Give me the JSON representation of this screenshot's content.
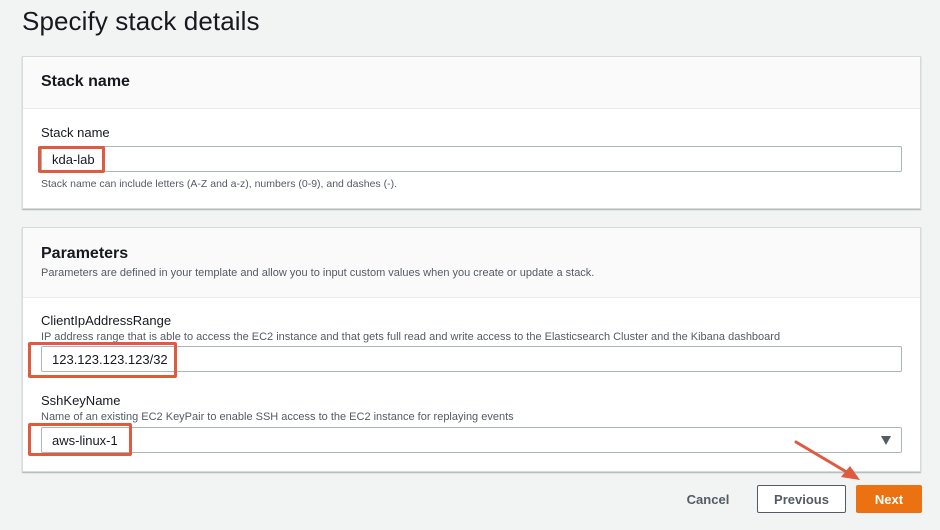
{
  "page": {
    "title": "Specify stack details"
  },
  "stack_name_panel": {
    "title": "Stack name",
    "field_label": "Stack name",
    "value": "kda-lab",
    "constraint": "Stack name can include letters (A-Z and a-z), numbers (0-9), and dashes (-)."
  },
  "parameters_panel": {
    "title": "Parameters",
    "description": "Parameters are defined in your template and allow you to input custom values when you create or update a stack.",
    "client_ip": {
      "label": "ClientIpAddressRange",
      "description": "IP address range that is able to access the EC2 instance and that gets full read and write access to the Elasticsearch Cluster and the Kibana dashboard",
      "value": "123.123.123.123/32"
    },
    "ssh_key": {
      "label": "SshKeyName",
      "description": "Name of an existing EC2 KeyPair to enable SSH access to the EC2 instance for replaying events",
      "value": "aws-linux-1",
      "dropdown_icon": "caret-down-icon"
    }
  },
  "footer": {
    "cancel_label": "Cancel",
    "previous_label": "Previous",
    "next_label": "Next"
  },
  "colors": {
    "primary_button": "#ec7211",
    "highlight_annotation": "#e05a3f",
    "page_background": "#f2f3f3"
  }
}
